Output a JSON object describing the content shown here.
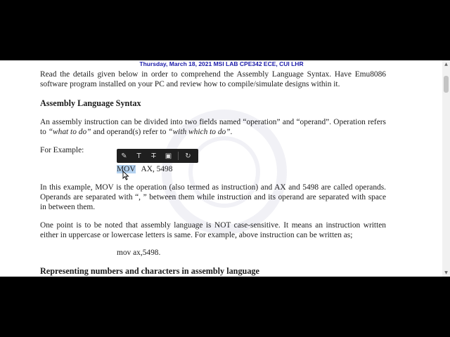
{
  "header": {
    "text": "Thursday, March 18, 2021  MSI LAB CPE342 ECE, CUI LHR"
  },
  "doc": {
    "intro": "Read the details given below in order to comprehend the Assembly Language Syntax. Have Emu8086 software program installed on your PC and review how to compile/simulate designs within it.",
    "heading1": "Assembly Language Syntax",
    "para1_a": "An assembly instruction can be divided into two fields named “operation” and “operand”. Operation refers to ",
    "para1_em1": "“what to do”",
    "para1_b": " and operand(s) refer to ",
    "para1_em2": "“with which to do”",
    "para1_c": ".",
    "example_label": "For Example:",
    "example_op": "MOV",
    "example_args": "AX, 5498",
    "para2": "In this example, MOV is the operation (also termed as instruction) and AX and 5498 are called operands. Operands are separated with “, ” between them while instruction and its operand are separated with space in between them.",
    "para3": "One point is to be noted that assembly language is NOT case-sensitive. It means an instruction written either in uppercase or lowercase letters is same. For example, above instruction can be written as;",
    "example2": "mov ax,5498.",
    "heading2": "Representing numbers and characters in assembly language"
  },
  "toolbar": {
    "tools": [
      {
        "name": "pen-icon",
        "glyph": "✎"
      },
      {
        "name": "text-icon",
        "glyph": "T"
      },
      {
        "name": "strikethrough-text-icon",
        "glyph": "T̶"
      },
      {
        "name": "highlight-icon",
        "glyph": "▣"
      }
    ],
    "extra_glyph": "↻"
  }
}
